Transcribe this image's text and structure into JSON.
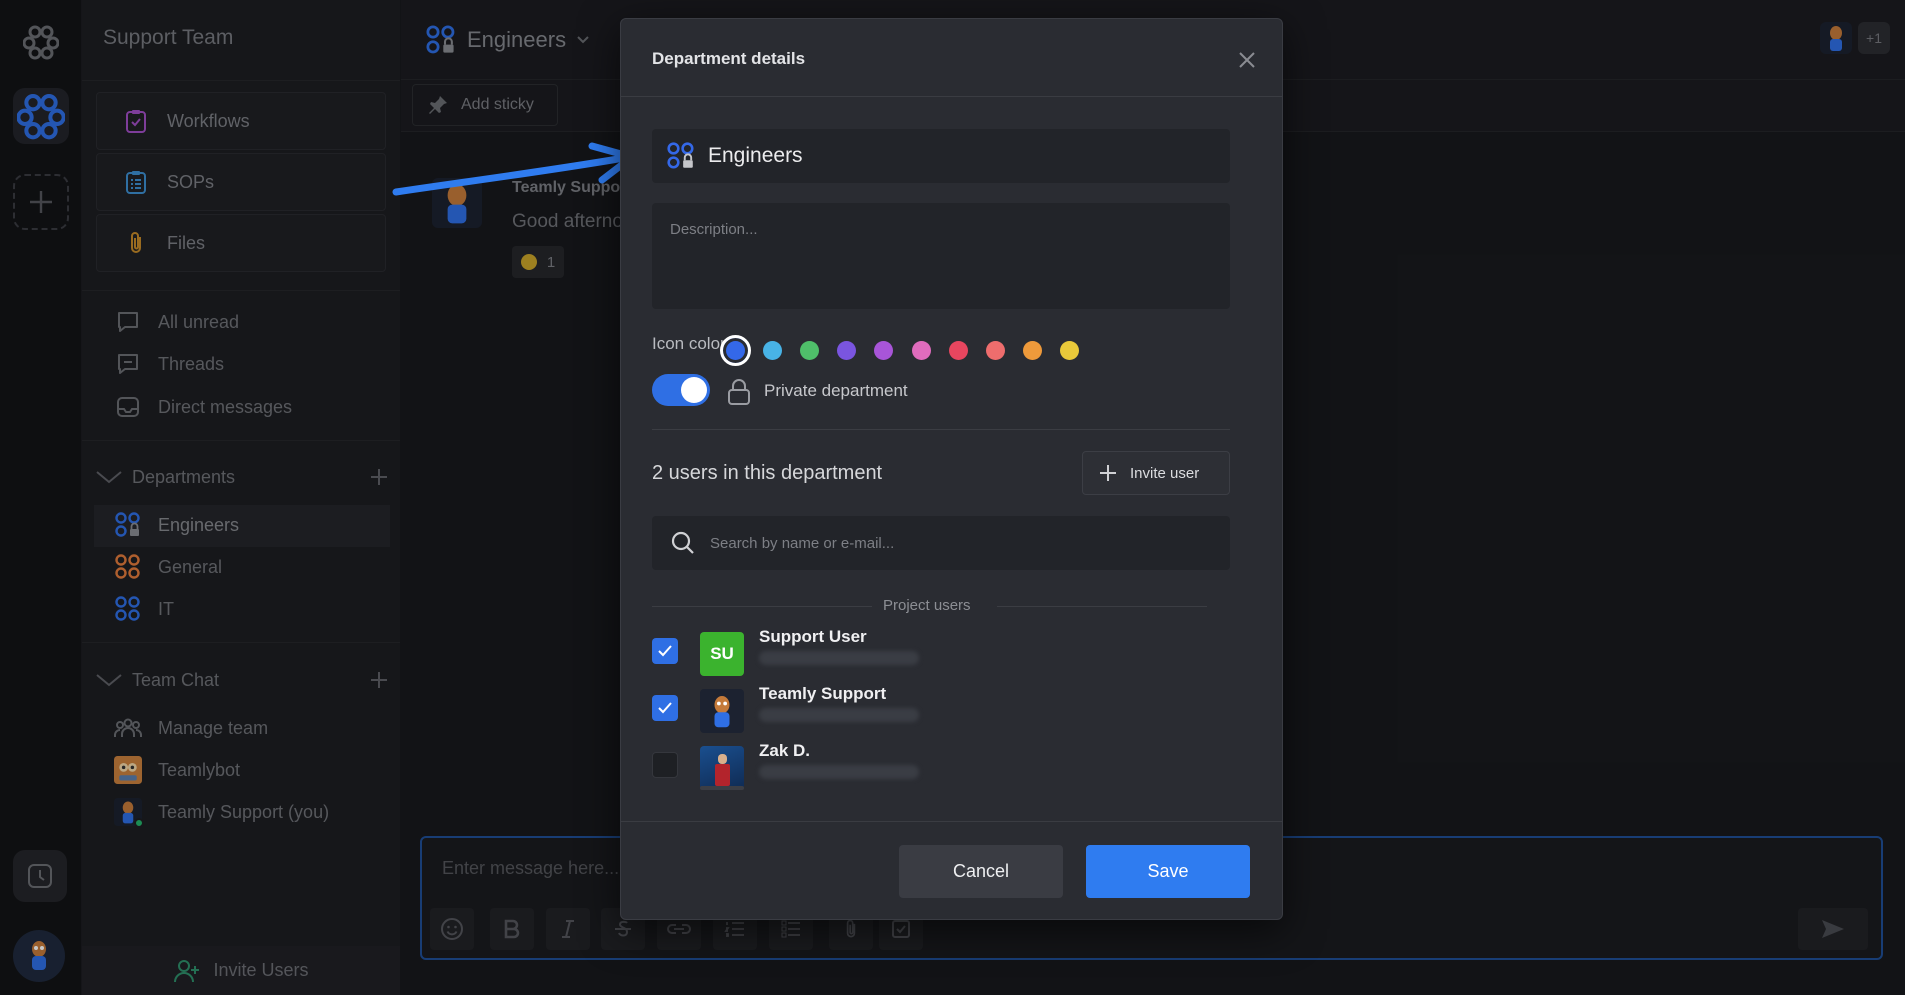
{
  "workspace": {
    "title": "Support Team"
  },
  "sidebar": {
    "nav_big": [
      {
        "label": "Workflows",
        "icon": "clipboard-check-icon"
      },
      {
        "label": "SOPs",
        "icon": "clipboard-list-icon"
      },
      {
        "label": "Files",
        "icon": "paperclip-icon"
      }
    ],
    "nav": [
      {
        "label": "All unread",
        "icon": "chat-bubble-icon"
      },
      {
        "label": "Threads",
        "icon": "threads-icon"
      },
      {
        "label": "Direct messages",
        "icon": "inbox-icon"
      }
    ],
    "departments_title": "Departments",
    "departments": [
      {
        "label": "Engineers",
        "color": "#2f6fe4"
      },
      {
        "label": "General",
        "color": "#e07a3c"
      },
      {
        "label": "IT",
        "color": "#2f6fe4"
      }
    ],
    "team_chat_title": "Team Chat",
    "team_chat": [
      {
        "label": "Manage team"
      },
      {
        "label": "Teamlybot"
      },
      {
        "label": "Teamly Support (you)"
      }
    ],
    "invite_label": "Invite Users"
  },
  "channel": {
    "title": "Engineers",
    "toolbar_sticky": "Add sticky",
    "message_author": "Teamly Suppor",
    "message_text": "Good afterno",
    "reaction_count": "1",
    "composer_placeholder": "Enter message here..."
  },
  "topbar": {
    "presence_extra": "+1"
  },
  "modal": {
    "title": "Department details",
    "name_value": "Engineers",
    "description_placeholder": "Description...",
    "icon_color_label": "Icon color:",
    "colors": [
      "#3468e8",
      "#48b3e6",
      "#4fbf6a",
      "#7a55e0",
      "#a855d8",
      "#e06cbd",
      "#e8465f",
      "#ee6d6d",
      "#ee9a3b",
      "#e9c93a"
    ],
    "selected_color": "#3468e8",
    "private_toggle_on": true,
    "private_label": "Private department",
    "users_count": "2 users in this department",
    "invite_button": "Invite user",
    "search_placeholder": "Search by name or e-mail...",
    "project_users_label": "Project users",
    "users": [
      {
        "name": "Support User",
        "initials": "SU",
        "checked": true
      },
      {
        "name": "Teamly Support",
        "checked": true
      },
      {
        "name": "Zak D.",
        "checked": false
      }
    ],
    "cancel_label": "Cancel",
    "save_label": "Save"
  }
}
